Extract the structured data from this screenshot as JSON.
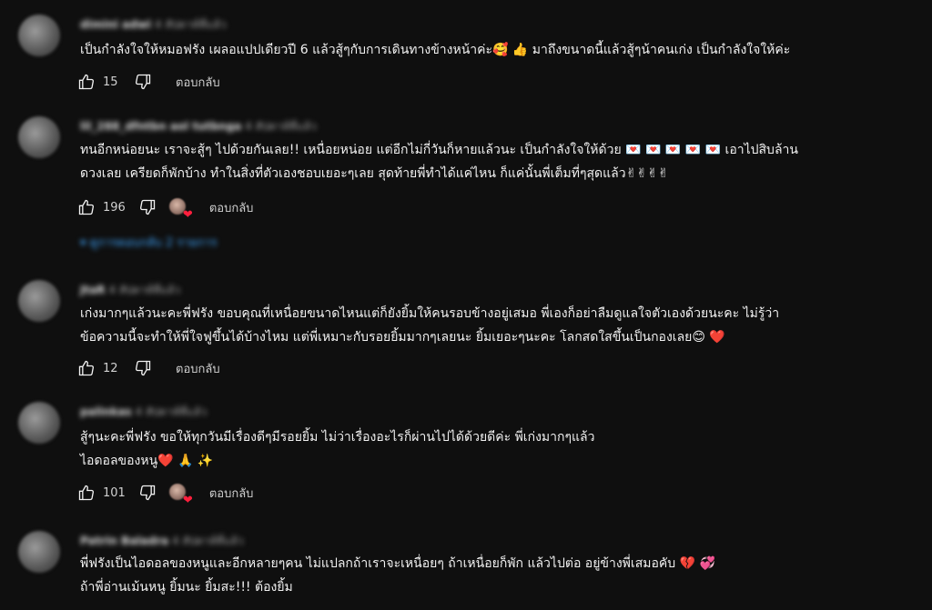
{
  "comments": [
    {
      "author": "dimini adwi",
      "time": "4 สัปดาห์ที่แล้ว",
      "text": "เป็นกำลังใจให้หมอฟรัง เผลอแปปเดียวปี 6 แล้วสู้ๆกับการเดินทางข้างหน้าค่ะ🥰 👍 มาถึงขนาดนี้แล้วสู้ๆน้าคนเก่ง เป็นกำลังใจให้ค่ะ",
      "likes": "15",
      "reply_label": "ตอบกลับ"
    },
    {
      "author": "lil_288_dfntbn aol tutbnga",
      "time": "4 สัปดาห์ที่แล้ว",
      "text_line1": "ทนอีกหน่อยนะ เราจะสู้ๆ ไปด้วยกันเลย!! เหนื่อยหน่อย  แต่อีกไม่กี่วันก็หายแล้วนะ เป็นกำลังใจให้ด้วย 💌 💌 💌 💌 💌  เอาไปสิบล้าน",
      "text_line2": "ดวงเลย เครียดก็พักบ้าง ทำในสิ่งที่ตัวเองชอบเยอะๆเลย สุดท้ายพี่ทำได้แค่ไหน ก็แค่นั้นพี่เต็มที่ๆสุดแล้ว✌✌✌✌",
      "likes": "196",
      "reply_label": "ตอบกลับ",
      "replies_toggle": "ดูการตอบกลับ 2 รายการ"
    },
    {
      "author": "JtaR",
      "time": "4 สัปดาห์ที่แล้ว",
      "text_line1": "เก่งมากๆแล้วนะคะพี่ฟรัง ขอบคุณที่เหนื่อยขนาดไหนแต่ก็ยังยิ้มให้คนรอบข้างอยู่เสมอ พี่เองก็อย่าลืมดูแลใจตัวเองด้วยนะคะ ไม่รู้ว่า",
      "text_line2": "ข้อความนี้จะทำให้พี่ใจฟูขึ้นได้บ้างไหม แต่พี่เหมาะกับรอยยิ้มมากๆเลยนะ ยิ้มเยอะๆนะคะ โลกสดใสขึ้นเป็นกองเลย😊 ❤️",
      "likes": "12",
      "reply_label": "ตอบกลับ"
    },
    {
      "author": "palinkas",
      "time": "4 สัปดาห์ที่แล้ว",
      "text_line1": "สู้ๆนะคะพี่ฟรัง ขอให้ทุกวันมีเรื่องดีๆมีรอยยิ้ม ไม่ว่าเรื่องอะไรก็ผ่านไปได้ด้วยดีค่ะ พี่เก่งมากๆแล้ว",
      "text_line2": "ไอดอลของหนู❤️ 🙏 ✨",
      "likes": "101",
      "reply_label": "ตอบกลับ"
    },
    {
      "author": "Patrin Baladra",
      "time": "4 สัปดาห์ที่แล้ว",
      "text_line1": "พี่ฟรังเป็นไอดอลของหนูและอีกหลายๆคน ไม่แปลกถ้าเราจะเหนื่อยๆ ถ้าเหนื่อยก็พัก แล้วไปต่อ อยู่ข้างพี่เสมอคับ 💔 💞",
      "text_line2": "ถ้าพี่อ่านเม้นหนู ยิ้มนะ ยิ้มสะ!!! ต้องยิ้ม"
    }
  ],
  "icons": {
    "like": "thumb-up-icon",
    "dislike": "thumb-down-icon",
    "heart": "creator-heart-icon"
  }
}
